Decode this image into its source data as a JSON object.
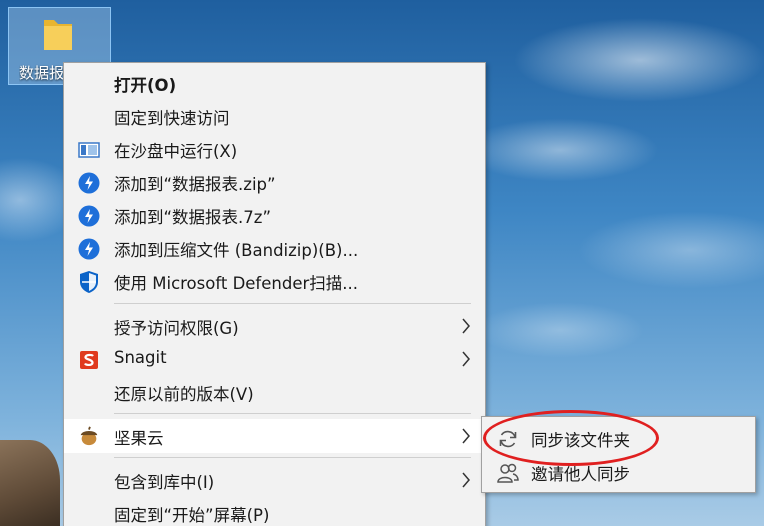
{
  "desktop": {
    "icon_label": "数据报"
  },
  "context_menu": {
    "items": [
      {
        "label": "打开(O)",
        "icon": "none"
      },
      {
        "label": "固定到快速访问",
        "icon": "none"
      },
      {
        "label": "在沙盘中运行(X)",
        "icon": "sandbox-icon"
      },
      {
        "label": "添加到“数据报表.zip”",
        "icon": "bandizip-icon"
      },
      {
        "label": "添加到“数据报表.7z”",
        "icon": "bandizip-icon"
      },
      {
        "label": "添加到压缩文件 (Bandizip)(B)...",
        "icon": "bandizip-icon"
      },
      {
        "label": "使用 Microsoft Defender扫描...",
        "icon": "defender-shield-icon"
      },
      {
        "label": "授予访问权限(G)",
        "icon": "none"
      },
      {
        "label": "Snagit",
        "icon": "snagit-icon"
      },
      {
        "label": "还原以前的版本(V)",
        "icon": "none"
      },
      {
        "label": "坚果云",
        "icon": "jianguoyun-nut-icon"
      },
      {
        "label": "包含到库中(I)",
        "icon": "none"
      },
      {
        "label": "固定到“开始”屏幕(P)",
        "icon": "none"
      }
    ]
  },
  "submenu": {
    "items": [
      {
        "label": "同步该文件夹",
        "icon": "sync-icon"
      },
      {
        "label": "邀请他人同步",
        "icon": "invite-users-icon"
      }
    ]
  },
  "colors": {
    "menu_bg": "#f2f2f2",
    "hover_bg": "#ffffff",
    "bandizip_blue": "#1e6fd9",
    "defender_blue": "#0b63c8",
    "snagit_red": "#e03a1e",
    "annotation_red": "#e02020"
  }
}
